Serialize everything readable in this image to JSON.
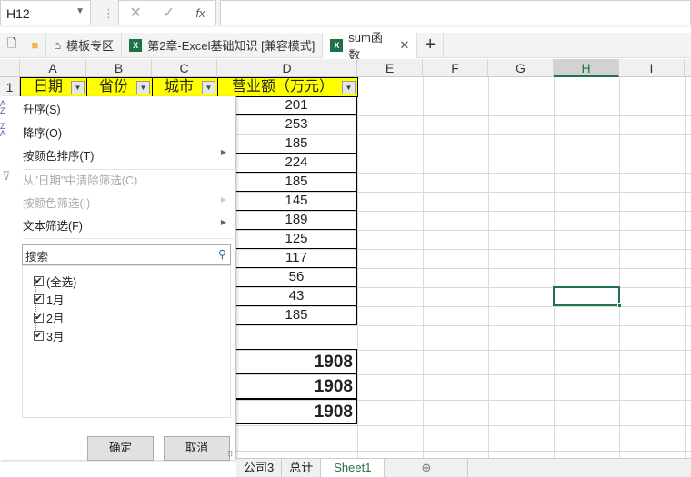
{
  "namebox": "H12",
  "formula_bar": {
    "cancel_icon": "✕",
    "enter_icon": "✓",
    "fx": "fx"
  },
  "file_tabs": [
    {
      "label": "模板专区"
    },
    {
      "label": "第2章-Excel基础知识  [兼容模式]"
    },
    {
      "label": "sum函数"
    }
  ],
  "columns": [
    "A",
    "B",
    "C",
    "D",
    "E",
    "F",
    "G",
    "H",
    "I"
  ],
  "rows": [
    "1"
  ],
  "headers": [
    "日期",
    "省份",
    "城市",
    "营业额（万元）"
  ],
  "revenue": [
    "201",
    "253",
    "185",
    "224",
    "185",
    "145",
    "189",
    "125",
    "117",
    "56",
    "43",
    "185"
  ],
  "totals": [
    "1908",
    "1908",
    "1908"
  ],
  "filter_menu": {
    "sort_asc": "升序(S)",
    "sort_desc": "降序(O)",
    "sort_color": "按颜色排序(T)",
    "clear_filter": "从\"日期\"中清除筛选(C)",
    "filter_color": "按颜色筛选(I)",
    "text_filter": "文本筛选(F)",
    "search_placeholder": "搜索",
    "items": [
      "(全选)",
      "1月",
      "2月",
      "3月"
    ],
    "ok": "确定",
    "cancel": "取消"
  },
  "sheet_tabs": [
    "公司3",
    "总计",
    "Sheet1"
  ],
  "accent": "#217346"
}
